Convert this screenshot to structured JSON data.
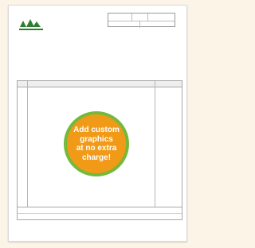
{
  "document": {
    "badge_text": "Add custom\ngraphics\nat no extra\ncharge!",
    "colors": {
      "page_background": "#fdf4e8",
      "badge_fill": "#f19a18",
      "badge_ring": "#74b93a",
      "logo_green": "#2e7d32"
    },
    "logo_icon": "trees-logo-icon"
  }
}
